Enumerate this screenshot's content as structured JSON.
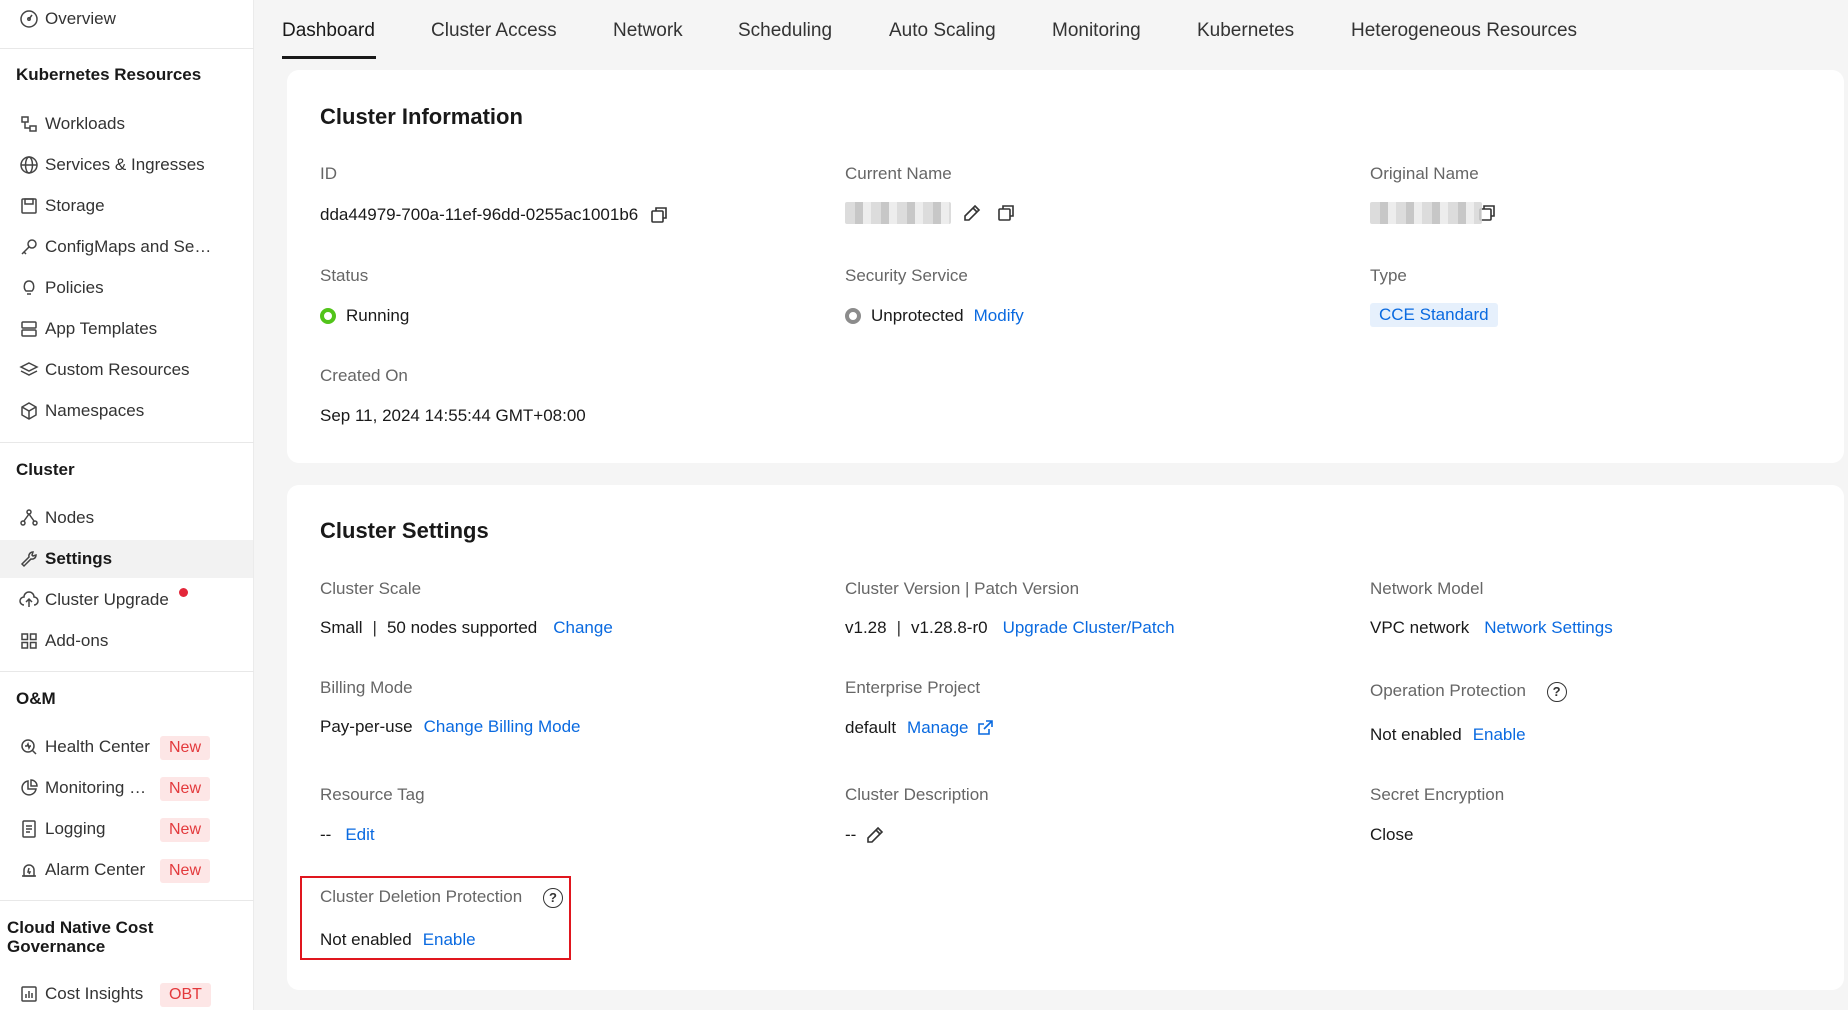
{
  "sidebar": {
    "overview": "Overview",
    "sections": {
      "kubernetes": "Kubernetes Resources",
      "cluster": "Cluster",
      "om": "O&M",
      "cost": "Cloud Native Cost Governance"
    },
    "k8s_items": [
      "Workloads",
      "Services & Ingresses",
      "Storage",
      "ConfigMaps and Se…",
      "Policies",
      "App Templates",
      "Custom Resources",
      "Namespaces"
    ],
    "cluster_items": [
      "Nodes",
      "Settings",
      "Cluster Upgrade",
      "Add-ons"
    ],
    "om_items": [
      "Health Center",
      "Monitoring …",
      "Logging",
      "Alarm Center"
    ],
    "badge_new": "New",
    "cost_items": [
      "Cost Insights"
    ],
    "badge_obt": "OBT"
  },
  "tabs": [
    "Dashboard",
    "Cluster Access",
    "Network",
    "Scheduling",
    "Auto Scaling",
    "Monitoring",
    "Kubernetes",
    "Heterogeneous Resources"
  ],
  "cluster_info": {
    "title": "Cluster Information",
    "id_label": "ID",
    "id_value": "dda44979-700a-11ef-96dd-0255ac1001b6",
    "current_name_label": "Current Name",
    "original_name_label": "Original Name",
    "status_label": "Status",
    "status_value": "Running",
    "security_label": "Security Service",
    "security_value": "Unprotected",
    "security_action": "Modify",
    "type_label": "Type",
    "type_value": "CCE Standard",
    "created_label": "Created On",
    "created_value": "Sep 11, 2024 14:55:44 GMT+08:00"
  },
  "cluster_settings": {
    "title": "Cluster Settings",
    "scale_label": "Cluster Scale",
    "scale_size": "Small",
    "scale_nodes": "50 nodes supported",
    "scale_action": "Change",
    "version_label": "Cluster Version | Patch Version",
    "version": "v1.28",
    "patch_version": "v1.28.8-r0",
    "version_action": "Upgrade Cluster/Patch",
    "network_label": "Network Model",
    "network_value": "VPC network",
    "network_action": "Network Settings",
    "billing_label": "Billing Mode",
    "billing_value": "Pay-per-use",
    "billing_action": "Change Billing Mode",
    "enterprise_label": "Enterprise Project",
    "enterprise_value": "default",
    "enterprise_action": "Manage",
    "op_protection_label": "Operation Protection",
    "op_protection_value": "Not enabled",
    "op_protection_action": "Enable",
    "tag_label": "Resource Tag",
    "tag_value": "--",
    "tag_action": "Edit",
    "description_label": "Cluster Description",
    "description_value": "--",
    "secret_label": "Secret Encryption",
    "secret_value": "Close",
    "deletion_label": "Cluster Deletion Protection",
    "deletion_value": "Not enabled",
    "deletion_action": "Enable"
  },
  "colors": {
    "link": "#0a6ae0",
    "running": "#52c41a",
    "unprotected": "#8c8c8c",
    "highlight": "#e0161e",
    "badge_bg": "#fde6e6",
    "badge_text": "#e3393c"
  }
}
